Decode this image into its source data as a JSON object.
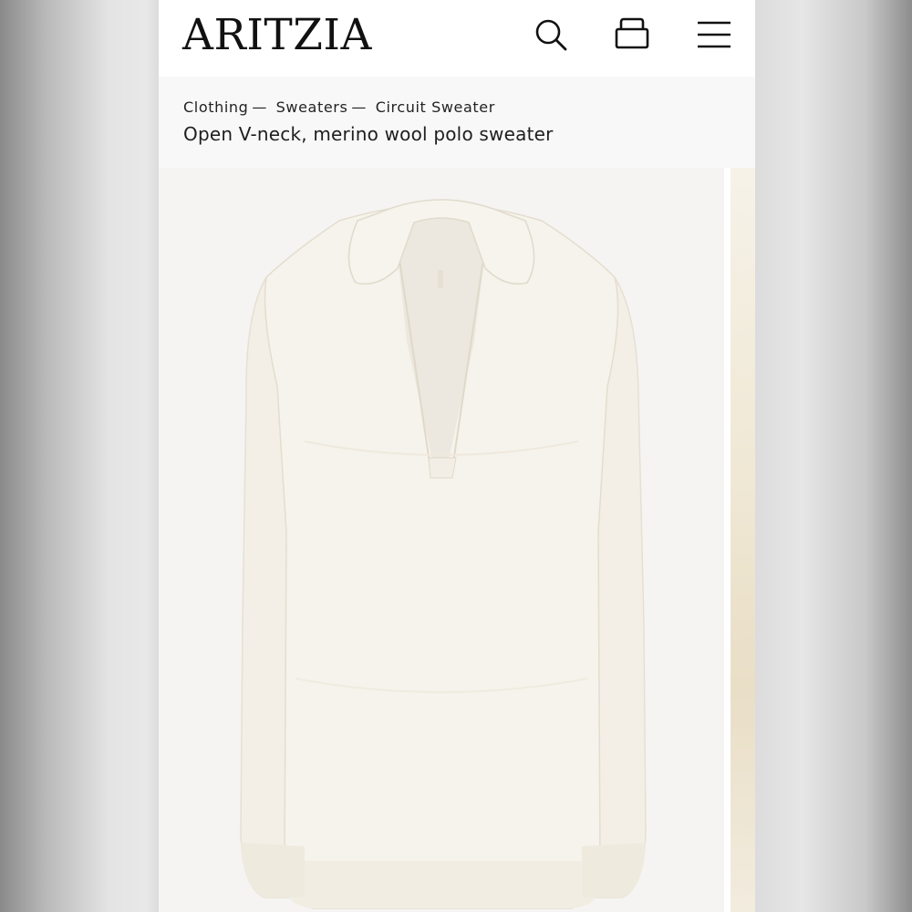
{
  "brand": {
    "logo_text": "ARITZIA"
  },
  "header": {
    "icons": [
      "search-icon",
      "shopping-bag-icon",
      "menu-icon"
    ]
  },
  "breadcrumb": {
    "items": [
      "Clothing",
      "Sweaters",
      "Circuit Sweater"
    ],
    "separator": "—"
  },
  "product": {
    "subtitle": "Open V-neck, merino wool polo sweater",
    "image_alt": "Circuit Sweater"
  },
  "colors": {
    "page_bg": "#ffffff",
    "crumb_bg": "#f8f8f8",
    "text": "#1e1e1e",
    "sweater": "#f6f3ec"
  }
}
